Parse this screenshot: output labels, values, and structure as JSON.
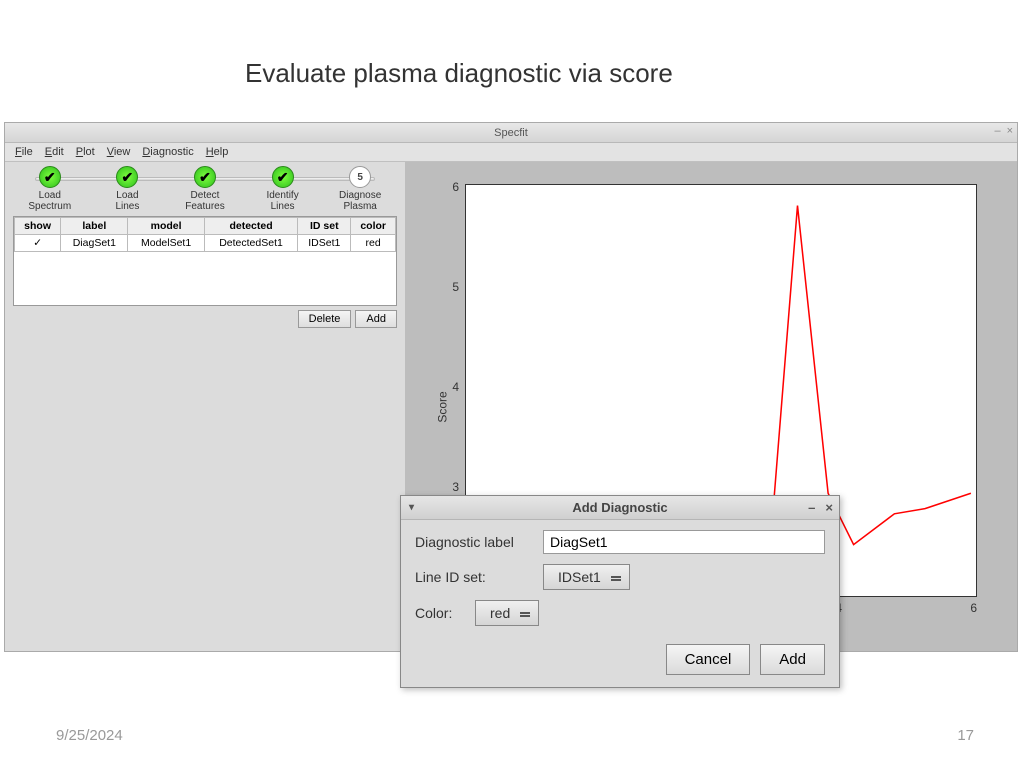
{
  "slide": {
    "title": "Evaluate plasma diagnostic via score",
    "date": "9/25/2024",
    "page": "17"
  },
  "app": {
    "title": "Specfit",
    "menu": [
      "File",
      "Edit",
      "Plot",
      "View",
      "Diagnostic",
      "Help"
    ],
    "steps": [
      {
        "label": "Load\nSpectrum",
        "state": "done"
      },
      {
        "label": "Load\nLines",
        "state": "done"
      },
      {
        "label": "Detect\nFeatures",
        "state": "done"
      },
      {
        "label": "Identify\nLines",
        "state": "done"
      },
      {
        "label": "Diagnose\nPlasma",
        "state": "num",
        "num": "5"
      }
    ],
    "table": {
      "headers": [
        "show",
        "label",
        "model",
        "detected",
        "ID set",
        "color"
      ],
      "row": {
        "show": "✓",
        "label": "DiagSet1",
        "model": "ModelSet1",
        "detected": "DetectedSet1",
        "idset": "IDSet1",
        "color": "red"
      }
    },
    "buttons": {
      "delete": "Delete",
      "add": "Add"
    }
  },
  "dialog": {
    "title": "Add Diagnostic",
    "label_lbl": "Diagnostic label",
    "label_val": "DiagSet1",
    "idset_lbl": "Line ID set:",
    "idset_val": "IDSet1",
    "color_lbl": "Color:",
    "color_val": "red",
    "cancel": "Cancel",
    "add": "Add"
  },
  "chart_data": {
    "type": "line",
    "ylabel": "Score",
    "ylim": [
      2,
      6
    ],
    "yticks": [
      3,
      4,
      5,
      6
    ],
    "xticks": [
      4,
      6
    ],
    "series": [
      {
        "name": "DiagSet1",
        "color": "red",
        "x": [
          3.5,
          3.75,
          4.0,
          4.25,
          4.5,
          4.75,
          5.0
        ],
        "y": [
          2.7,
          5.8,
          3.0,
          2.5,
          2.8,
          2.85,
          3.0
        ]
      }
    ]
  }
}
